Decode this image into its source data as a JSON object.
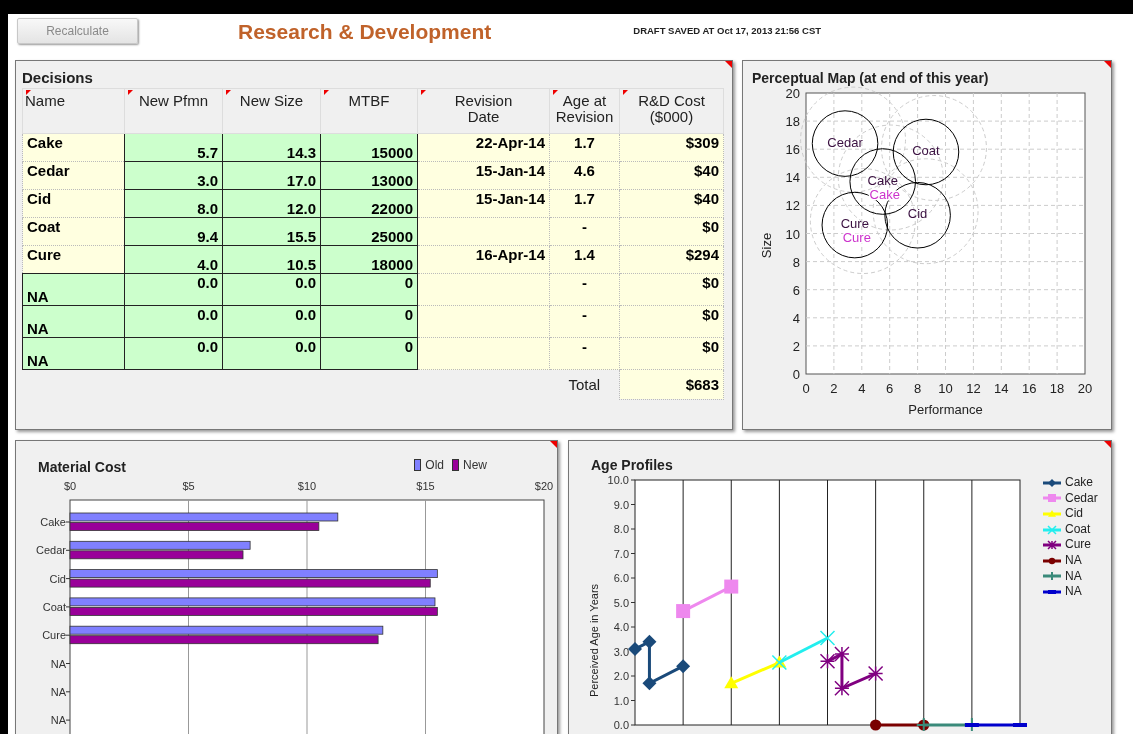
{
  "header": {
    "button": {
      "label": "Recalculate",
      "disabled": true
    },
    "title": "Research & Development",
    "status": "DRAFT SAVED AT Oct 17, 2013 21:56 CST"
  },
  "decisions": {
    "title": "Decisions",
    "columns": [
      {
        "lines": [
          "Name"
        ]
      },
      {
        "lines": [
          "New Pfmn"
        ]
      },
      {
        "lines": [
          "New Size"
        ]
      },
      {
        "lines": [
          "MTBF"
        ]
      },
      {
        "lines": [
          "Revision",
          "Date"
        ]
      },
      {
        "lines": [
          "Age at",
          "Revision"
        ]
      },
      {
        "lines": [
          "R&D Cost",
          "($000)"
        ]
      }
    ],
    "rows": [
      {
        "kind": "product",
        "cells": [
          "Cake",
          "5.7",
          "14.3",
          "15000",
          "22-Apr-14",
          "1.7",
          "$309"
        ]
      },
      {
        "kind": "product",
        "cells": [
          "Cedar",
          "3.0",
          "17.0",
          "13000",
          "15-Jan-14",
          "4.6",
          "$40"
        ]
      },
      {
        "kind": "product",
        "cells": [
          "Cid",
          "8.0",
          "12.0",
          "22000",
          "15-Jan-14",
          "1.7",
          "$40"
        ]
      },
      {
        "kind": "product",
        "cells": [
          "Coat",
          "9.4",
          "15.5",
          "25000",
          null,
          "-",
          "$0"
        ]
      },
      {
        "kind": "product",
        "cells": [
          "Cure",
          "4.0",
          "10.5",
          "18000",
          "16-Apr-14",
          "1.4",
          "$294"
        ]
      },
      {
        "kind": "unassigned",
        "cells": [
          "NA",
          "0.0",
          "0.0",
          "0",
          null,
          "-",
          "$0"
        ]
      },
      {
        "kind": "unassigned",
        "cells": [
          "NA",
          "0.0",
          "0.0",
          "0",
          null,
          "-",
          "$0"
        ]
      },
      {
        "kind": "unassigned",
        "cells": [
          "NA",
          "0.0",
          "0.0",
          "0",
          null,
          "-",
          "$0"
        ]
      }
    ],
    "total": {
      "label": "Total",
      "value": "$683"
    }
  },
  "perceptual_map": {
    "chart_data": {
      "type": "scatter",
      "title": "Perceptual Map (at end of this year)",
      "xlabel": "Performance",
      "ylabel": "Size",
      "xlim": [
        0,
        20
      ],
      "ylim": [
        0,
        20
      ],
      "xticks": [
        0,
        2,
        4,
        6,
        8,
        10,
        12,
        14,
        16,
        18,
        20
      ],
      "yticks": [
        0,
        2,
        4,
        6,
        8,
        10,
        12,
        14,
        16,
        18,
        20
      ],
      "grid": true,
      "x": [
        2.8,
        5.5,
        8.6,
        8.0,
        3.5
      ],
      "series": [
        {
          "name": "Cedar",
          "color": "#000000",
          "values": [
            16.4,
            null,
            null,
            null,
            null
          ]
        },
        {
          "name": "Cake",
          "color": "#000000",
          "values": [
            null,
            13.7,
            null,
            null,
            null
          ]
        },
        {
          "name": "Coat",
          "color": "#000000",
          "values": [
            null,
            null,
            15.8,
            null,
            null
          ]
        },
        {
          "name": "Cid",
          "color": "#000000",
          "values": [
            null,
            null,
            null,
            11.3,
            null
          ]
        },
        {
          "name": "Cure",
          "color": "#000000",
          "values": [
            null,
            null,
            null,
            null,
            10.6
          ]
        }
      ],
      "annotations": [
        {
          "text": "Cake",
          "x": 5.5,
          "y": 13.7
        },
        {
          "text": "Cure",
          "x": 3.5,
          "y": 10.6
        }
      ]
    }
  },
  "material_cost": {
    "chart_data": {
      "type": "bar",
      "orientation": "horizontal",
      "title": "Material Cost",
      "grid": true,
      "categories": [
        "Cake",
        "Cedar",
        "Cid",
        "Coat",
        "Cure",
        "NA",
        "NA",
        "NA"
      ],
      "xlim": [
        0,
        20
      ],
      "xticks": [
        {
          "value": 0,
          "label": "$0"
        },
        {
          "value": 5,
          "label": "$5"
        },
        {
          "value": 10,
          "label": "$10"
        },
        {
          "value": 15,
          "label": "$15"
        },
        {
          "value": 20,
          "label": "$20"
        }
      ],
      "series": [
        {
          "name": "Old",
          "color": "#8080ff",
          "values": [
            11.3,
            7.6,
            15.5,
            15.4,
            13.2,
            null,
            null,
            null
          ]
        },
        {
          "name": "New",
          "color": "#990099",
          "values": [
            10.5,
            7.3,
            15.2,
            15.5,
            13.0,
            null,
            null,
            null
          ]
        }
      ]
    }
  },
  "age_profiles": {
    "title": "Age Profiles",
    "y_axis_label": "Perceived Age in Years",
    "y_ticks": [
      "10.0",
      "9.0",
      "8.0",
      "7.0",
      "6.0",
      "5.0",
      "4.0",
      "3.0",
      "2.0",
      "1.0",
      "0.0"
    ],
    "legend": [
      {
        "name": "Cake",
        "color": "#1a4a7a",
        "kind": "diamond"
      },
      {
        "name": "Cedar",
        "color": "#ee88ee",
        "kind": "square"
      },
      {
        "name": "Cid",
        "color": "#ffff00",
        "kind": "triangle"
      },
      {
        "name": "Coat",
        "color": "#22eeee",
        "kind": "cross"
      },
      {
        "name": "Cure",
        "color": "#800080",
        "kind": "star"
      },
      {
        "name": "NA",
        "color": "#7a0000",
        "kind": "circle"
      },
      {
        "name": "NA",
        "color": "#3a8a7a",
        "kind": "plus"
      },
      {
        "name": "NA",
        "color": "#0000cc",
        "kind": "dash"
      }
    ]
  }
}
